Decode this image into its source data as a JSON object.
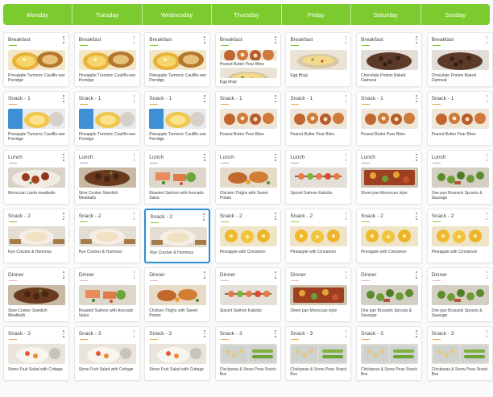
{
  "colors": {
    "header": "#7ccb2e",
    "breakfast": "#7ccb2e",
    "snack1": "#e8a63a",
    "lunch": "#9aa0c8",
    "snack2": "#7ccb2e",
    "dinner": "#e6b6c8",
    "snack3": "#e8a63a",
    "selected_border": "#2d8fd5"
  },
  "days": [
    "Monday",
    "Tuesday",
    "Wednesday",
    "Thursday",
    "Friday",
    "Saturday",
    "Sunday"
  ],
  "rows": [
    {
      "slot": "Breakfast",
      "color_key": "breakfast",
      "cells": [
        {
          "title": "Pineapple Turmeric Cauliflo-wer Porridge",
          "img": "porridge"
        },
        {
          "title": "Pineapple Turmeric Cauliflo-wer Porridge",
          "img": "porridge"
        },
        {
          "title": "Pineapple Turmeric Cauliflo-wer Porridge",
          "img": "porridge"
        },
        {
          "title": "Peanut Butter Pear Bites",
          "img": "pear",
          "title2": "Egg bhuji",
          "img2": "egg"
        },
        {
          "title": "Egg Bhuji",
          "img": "egg"
        },
        {
          "title": "Chocolate Protein Baked Oatmeal",
          "img": "oatmeal"
        },
        {
          "title": "Chocolate Protein Baked Oatmeal",
          "img": "oatmeal"
        }
      ]
    },
    {
      "slot": "Snack - 1",
      "color_key": "snack1",
      "cells": [
        {
          "title": "Pineapple Turmeric Cauliflo-wer Porridge",
          "img": "snackbowl"
        },
        {
          "title": "Pineapple Turmeric Cauliflo-wer Porridge",
          "img": "snackbowl"
        },
        {
          "title": "Pineapple Turmeric Cauliflo-wer Porridge",
          "img": "snackbowl"
        },
        {
          "title": "Peanut Butter Pear Bites",
          "img": "pear"
        },
        {
          "title": "Peanut Butter Pear Bites",
          "img": "pear"
        },
        {
          "title": "Peanut Butter Pear Bites",
          "img": "pear"
        },
        {
          "title": "Peanut Butter Pear Bites",
          "img": "pear"
        }
      ]
    },
    {
      "slot": "Lunch",
      "color_key": "lunch",
      "cells": [
        {
          "title": "Moroccan Lamb meatballs",
          "img": "meatballs"
        },
        {
          "title": "Slow Cooker Swedish Meatballs",
          "img": "swedish"
        },
        {
          "title": "Roasted Salmon with Avocado Salsa",
          "img": "salmon"
        },
        {
          "title": "Chicken Thighs with Sweet Potato",
          "img": "chicken"
        },
        {
          "title": "Spiced Salmon Kabobs",
          "img": "kabob"
        },
        {
          "title": "Sheet pan Moroccan style",
          "img": "sheetpan"
        },
        {
          "title": "One pan Brussels Sprouts & Sausage",
          "img": "brussels"
        }
      ]
    },
    {
      "slot": "Snack - 2",
      "color_key": "snack2",
      "cells": [
        {
          "title": "Rye Cracker & Hummus",
          "img": "hummus"
        },
        {
          "title": "Rye Cracker & Hummus",
          "img": "hummus"
        },
        {
          "title": "Rye Cracker & Hummus",
          "img": "hummus",
          "selected": true
        },
        {
          "title": "Pineapple with Cinnamon",
          "img": "pineapple"
        },
        {
          "title": "Pineapple with Cinnamon",
          "img": "pineapple"
        },
        {
          "title": "Pineapple with Cinnamon",
          "img": "pineapple"
        },
        {
          "title": "Pineapple with Cinnamon",
          "img": "pineapple"
        }
      ]
    },
    {
      "slot": "Dinner",
      "color_key": "dinner",
      "cells": [
        {
          "title": "Slow Cooker Swedish Meatballs",
          "img": "swedish"
        },
        {
          "title": "Roasted Salmon with Avocado Salsa",
          "img": "salmon"
        },
        {
          "title": "Chicken Thighs with Sweet Potato",
          "img": "chicken"
        },
        {
          "title": "Spiced Salmon Kabobs",
          "img": "kabob"
        },
        {
          "title": "Sheet pan Moroccan style",
          "img": "sheetpan"
        },
        {
          "title": "One pan Brussels Sprouts & Sausage",
          "img": "brussels"
        },
        {
          "title": "One pan Brussels Sprouts & Sausage",
          "img": "brussels"
        }
      ]
    },
    {
      "slot": "Snack - 3",
      "color_key": "snack3",
      "cells": [
        {
          "title": "Stone Fruit Salad with Cottage",
          "img": "cottage"
        },
        {
          "title": "Stone Fruit Salad with Cottage",
          "img": "cottage"
        },
        {
          "title": "Stone Fruit Salad with Cottage",
          "img": "cottage"
        },
        {
          "title": "Chickpeas & Snow Peas Snack Box",
          "img": "snackbox"
        },
        {
          "title": "Chickpeas & Snow Peas Snack Box",
          "img": "snackbox"
        },
        {
          "title": "Chickpeas & Snow Peas Snack Box",
          "img": "snackbox"
        },
        {
          "title": "Chickpeas & Snow Peas Snack Box",
          "img": "snackbox"
        }
      ]
    }
  ]
}
